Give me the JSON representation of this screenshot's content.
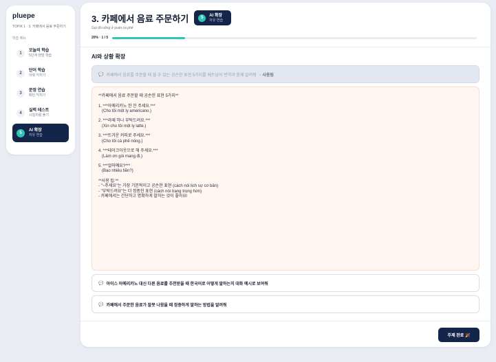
{
  "sidebar": {
    "logo": "pluepe",
    "course": "TOPIK 1 · 3. 카페에서 음료 주문하기",
    "menu_title": "학습 메뉴",
    "items": [
      {
        "num": "1",
        "title": "오늘의 학습",
        "sub": "5단계 랜덤 학습"
      },
      {
        "num": "2",
        "title": "단어 학습",
        "sub": "어휘 익히기"
      },
      {
        "num": "3",
        "title": "문장 연습",
        "sub": "패턴 익히기"
      },
      {
        "num": "4",
        "title": "실력 테스트",
        "sub": "시험처럼 풀기"
      },
      {
        "num": "5",
        "title": "AI 확장",
        "sub": "자유 연습"
      }
    ]
  },
  "header": {
    "title": "3. 카페에서 음료 주문하기",
    "badge_num": "5",
    "badge_title": "AI 확장",
    "badge_sub": "자유 연습",
    "subtitle": "Gọi đồ uống ở quán cà phê",
    "progress_label": "20% · 1 / 5",
    "progress_fraction": 0.2
  },
  "section": {
    "title": "AI와 상황 확장"
  },
  "prompt": {
    "icon": "chat-icon",
    "text": "카페에서 음료를 주문할 때 쓸 수 있는 공손한 표현 5가지를 베트남어 번역과 함께 알려줘",
    "status": "· 사용됨"
  },
  "answer": {
    "text": "**카페에서 음료 주문할 때 공손한 표현 5가지**\n\n1. ***아메리카노 한 잔 주세요.***\n   (Cho tôi một ly americano.)\n\n2. ***라떼 하나 부탁드려요.***\n   (Xin cho tôi một ly latte.)\n\n3. ***뜨거운 커피로 주세요.***\n   (Cho tôi cà phê nóng.)\n\n4. ***테이크아웃으로 해 주세요.***\n   (Làm ơn gói mang đi.)\n\n5. ***얼마예요?***\n   (Bao nhiêu tiền?)\n\n**사용 팁:**\n- \"~주세요\"는 가장 기본적이고 공손한 표현 (cách nói lịch sự cơ bản)\n- \"부탁드려요\"는 더 정중한 표현 (cách nói trang trọng hơn)\n- 카페에서는 간단하고 명확하게 말하는 것이 좋아요!"
  },
  "suggestions": [
    {
      "icon": "chat-icon",
      "text": "아이스 아메리카노 대신 다른 음료를 추천받을 때 한국어로 어떻게 말하는지 대화 예시로 보여줘"
    },
    {
      "icon": "chat-icon",
      "text": "카페에서 주문한 음료가 잘못 나왔을 때 정중하게 말하는 방법을 알려줘"
    }
  ],
  "footer": {
    "complete_label": "주제 완료 🎉"
  },
  "colors": {
    "navy": "#14254a",
    "teal": "#2ec4b6",
    "answer_bg": "#fff5f1"
  }
}
